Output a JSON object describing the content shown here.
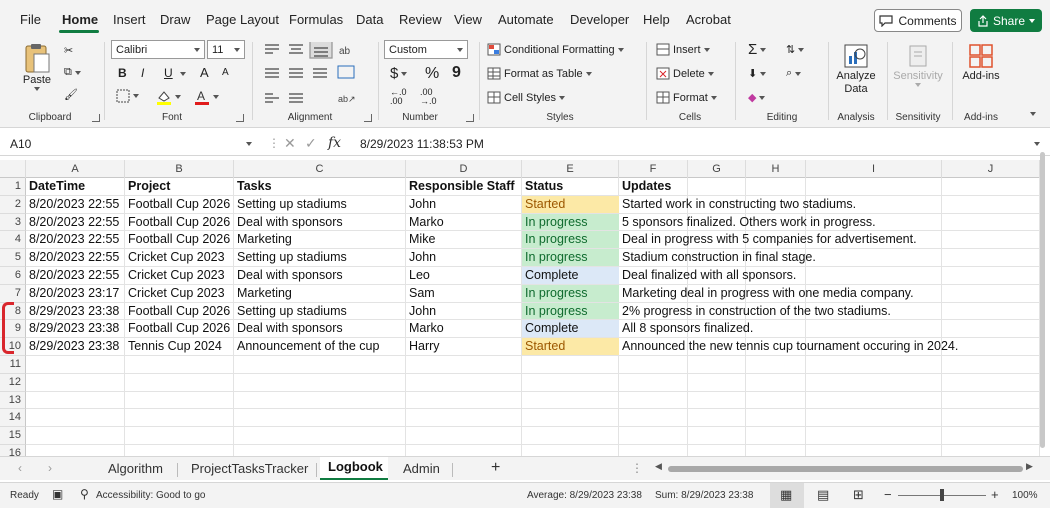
{
  "menu": {
    "items": [
      "File",
      "Home",
      "Insert",
      "Draw",
      "Page Layout",
      "Formulas",
      "Data",
      "Review",
      "View",
      "Automate",
      "Developer",
      "Help",
      "Acrobat"
    ],
    "comments_label": "Comments",
    "share_label": "Share"
  },
  "ribbon": {
    "clipboard": {
      "paste": "Paste",
      "group": "Clipboard"
    },
    "font": {
      "family": "Calibri",
      "size": "11",
      "bold": "B",
      "italic": "I",
      "underline": "U",
      "grow": "A",
      "shrink": "A",
      "group": "Font"
    },
    "alignment": {
      "group": "Alignment"
    },
    "number": {
      "format": "Custom",
      "currency": "$",
      "percent": "%",
      "comma": "9",
      "group": "Number"
    },
    "styles": {
      "conditional": "Conditional Formatting",
      "table": "Format as Table",
      "cell": "Cell Styles",
      "group": "Styles"
    },
    "cells": {
      "insert": "Insert",
      "delete": "Delete",
      "format": "Format",
      "group": "Cells"
    },
    "editing": {
      "group": "Editing",
      "sum": "Σ"
    },
    "analysis": {
      "analyze": "Analyze Data",
      "group": "Analysis"
    },
    "sensitivity": {
      "label": "Sensitivity",
      "group": "Sensitivity"
    },
    "addins": {
      "label": "Add-ins",
      "group": "Add-ins"
    }
  },
  "formula_bar": {
    "name_box": "A10",
    "fx": "fx",
    "formula": "8/29/2023  11:38:53 PM"
  },
  "grid": {
    "columns": [
      "A",
      "B",
      "C",
      "D",
      "E",
      "F",
      "G",
      "H",
      "I",
      "J"
    ],
    "row_numbers": [
      "1",
      "2",
      "3",
      "4",
      "5",
      "6",
      "7",
      "8",
      "9",
      "10",
      "11",
      "12",
      "13",
      "14",
      "15",
      "16"
    ],
    "headers": [
      "DateTime",
      "Project",
      "Tasks",
      "Responsible Staff",
      "Status",
      "Updates"
    ],
    "rows": [
      [
        "8/20/2023 22:55",
        "Football Cup 2026",
        "Setting up stadiums",
        "John",
        "Started",
        "Started work in constructing two stadiums."
      ],
      [
        "8/20/2023 22:55",
        "Football Cup 2026",
        "Deal with sponsors",
        "Marko",
        "In progress",
        "5 sponsors finalized. Others work in progress."
      ],
      [
        "8/20/2023 22:55",
        "Football Cup 2026",
        "Marketing",
        "Mike",
        "In progress",
        "Deal in progress with 5 companies for advertisement."
      ],
      [
        "8/20/2023 22:55",
        "Cricket Cup 2023",
        "Setting up stadiums",
        "John",
        "In progress",
        "Stadium construction in final stage."
      ],
      [
        "8/20/2023 22:55",
        "Cricket Cup 2023",
        "Deal with sponsors",
        "Leo",
        "Complete",
        "Deal finalized with all sponsors."
      ],
      [
        "8/20/2023 23:17",
        "Cricket Cup 2023",
        "Marketing",
        "Sam",
        "In progress",
        "Marketing deal in progress with one media company."
      ],
      [
        "8/29/2023 23:38",
        "Football Cup 2026",
        "Setting up stadiums",
        "John",
        "In progress",
        "2% progress in construction of the two stadiums."
      ],
      [
        "8/29/2023 23:38",
        "Football Cup 2026",
        "Deal with sponsors",
        "Marko",
        "Complete",
        "All 8 sponsors finalized."
      ],
      [
        "8/29/2023 23:38",
        "Tennis Cup 2024",
        "Announcement of the cup",
        "Harry",
        "Started",
        "Announced the new tennis cup tournament occuring in 2024."
      ]
    ],
    "status_colors": {
      "Started": "#fce9a6",
      "In progress": "#c7ecce",
      "Complete": "#dce8f7"
    },
    "status_text_colors": {
      "Started": "#9c5700",
      "In progress": "#0f6b2e",
      "Complete": "#111111"
    }
  },
  "sheets": {
    "tabs": [
      "Algorithm",
      "ProjectTasksTracker",
      "Logbook",
      "Admin"
    ],
    "active": "Logbook",
    "add": "+"
  },
  "status_bar": {
    "mode": "Ready",
    "accessibility": "Accessibility: Good to go",
    "average": "Average: 8/29/2023 23:38",
    "sum": "Sum: 8/29/2023 23:38",
    "zoom": "100%"
  },
  "colors": {
    "accent": "#107c41",
    "annotation": "#d9262c"
  }
}
